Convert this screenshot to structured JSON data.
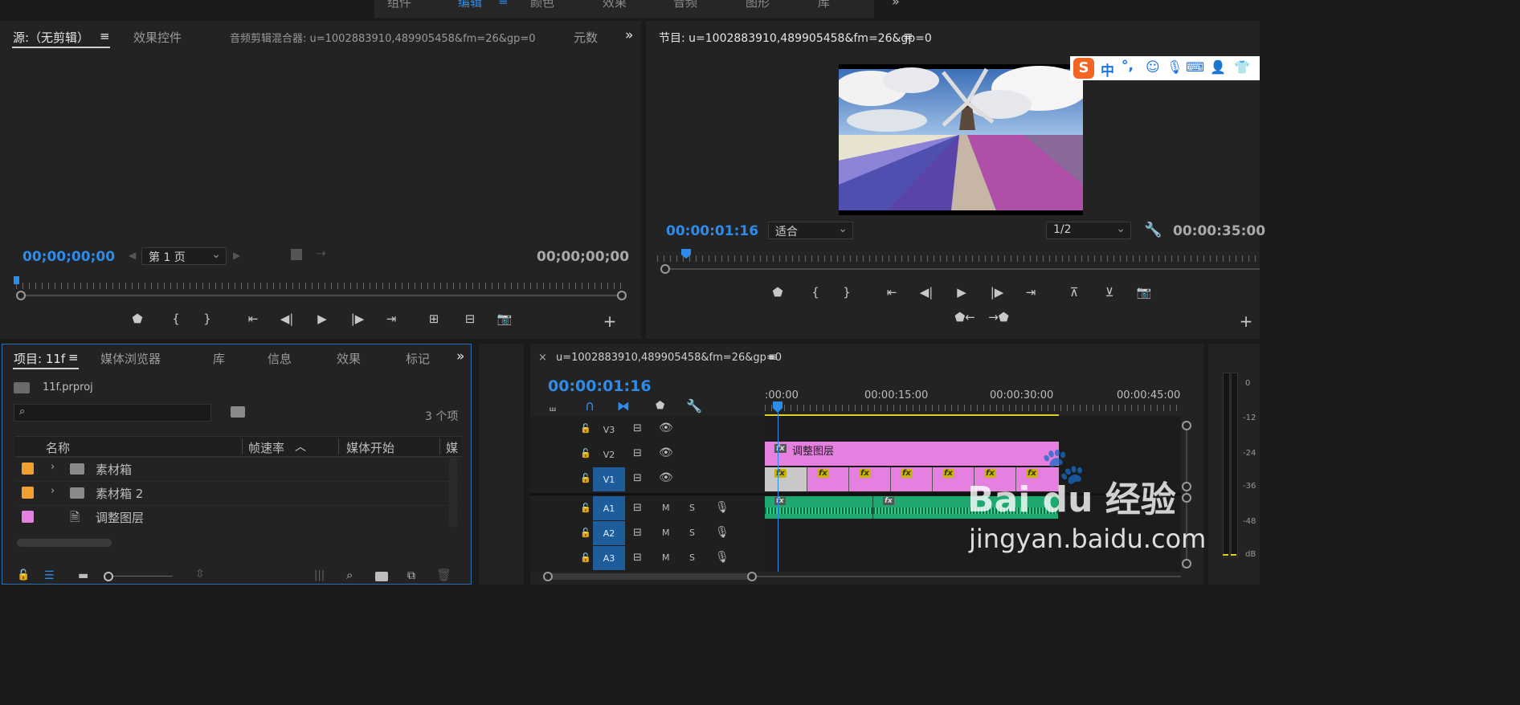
{
  "workspaces": {
    "items": [
      "组件",
      "编辑",
      "颜色",
      "效果",
      "音频",
      "图形",
      "库"
    ],
    "active": "编辑",
    "more": "»"
  },
  "source_panel": {
    "tabs": [
      "源:（无剪辑）",
      "效果控件",
      "音频剪辑混合器: u=1002883910,489905458&fm=26&gp=0",
      "元数"
    ],
    "menu_icon": "≡",
    "overflow": "»",
    "timecode_left": "00;00;00;00",
    "page_select": "第 1 页",
    "timecode_right": "00;00;00;00"
  },
  "program_panel": {
    "title": "节目: u=1002883910,489905458&fm=26&gp=0",
    "menu_icon": "≡",
    "timecode": "00:00:01:16",
    "fit_select": "适合",
    "resolution_select": "1/2",
    "duration": "00:00:35:00"
  },
  "ime_bar": {
    "logo": "S",
    "lang": "中",
    "punct": "°,"
  },
  "project_panel": {
    "tabs": [
      "项目: 11f",
      "媒体浏览器",
      "库",
      "信息",
      "效果",
      "标记"
    ],
    "menu_icon": "≡",
    "overflow": "»",
    "file_name": "11f.prproj",
    "search_placeholder": "",
    "item_count": "3 个项",
    "columns": [
      "名称",
      "帧速率",
      "媒体开始",
      "媒"
    ],
    "items": [
      {
        "name": "素材箱",
        "color": "#f0a030",
        "type": "bin"
      },
      {
        "name": "素材箱 2",
        "color": "#f0a030",
        "type": "bin"
      },
      {
        "name": "调整图层",
        "color": "#e680e0",
        "type": "adjustment-layer"
      }
    ]
  },
  "timeline_panel": {
    "close": "×",
    "title": "u=1002883910,489905458&fm=26&gp=0",
    "menu_icon": "≡",
    "timecode": "00:00:01:16",
    "ruler_labels": [
      ":00:00",
      "00:00:15:00",
      "00:00:30:00",
      "00:00:45:00"
    ],
    "video_tracks": [
      {
        "id": "V3",
        "target": false
      },
      {
        "id": "V2",
        "target": false
      },
      {
        "id": "V1",
        "target": true
      }
    ],
    "audio_tracks": [
      {
        "id": "A1",
        "target": true,
        "m": "M",
        "s": "S"
      },
      {
        "id": "A2",
        "target": true,
        "m": "M",
        "s": "S"
      },
      {
        "id": "A3",
        "target": true,
        "m": "M",
        "s": "S"
      }
    ],
    "adjustment_clip_label": "调整图层",
    "fx_label": "fx",
    "playhead_frames": 40,
    "clip_colors": {
      "adjustment": "#e680e0",
      "video": "#e680e0",
      "audio": "#1fa870",
      "gap": "#c8c8c8"
    }
  },
  "audio_meter": {
    "labels": [
      "0",
      "-12",
      "-24",
      "-36",
      "-48",
      "dB"
    ]
  },
  "watermark": {
    "brand": "Bai du 经验",
    "url": "jingyan.baidu.com"
  }
}
